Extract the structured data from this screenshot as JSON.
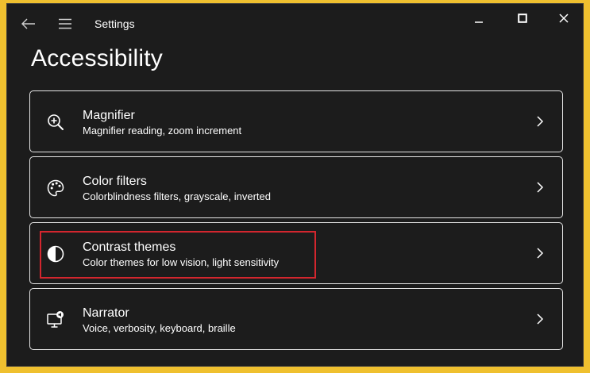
{
  "window": {
    "app_title": "Settings",
    "page_title": "Accessibility"
  },
  "titlebar_icons": {
    "back": "back-arrow-icon",
    "menu": "hamburger-menu-icon",
    "minimize": "minimize-icon",
    "maximize": "maximize-icon",
    "close": "close-icon"
  },
  "items": [
    {
      "title": "Magnifier",
      "description": "Magnifier reading, zoom increment",
      "icon": "magnifier-icon"
    },
    {
      "title": "Color filters",
      "description": "Colorblindness filters, grayscale, inverted",
      "icon": "palette-icon"
    },
    {
      "title": "Contrast themes",
      "description": "Color themes for low vision, light sensitivity",
      "icon": "contrast-icon",
      "highlighted": true
    },
    {
      "title": "Narrator",
      "description": "Voice, verbosity, keyboard, braille",
      "icon": "narrator-icon"
    }
  ],
  "colors": {
    "background": "#1c1c1c",
    "frame": "#efc02f",
    "highlight": "#d3262e",
    "text": "#ffffff"
  }
}
